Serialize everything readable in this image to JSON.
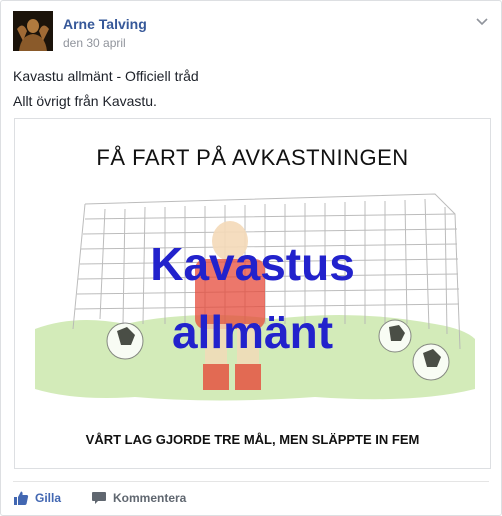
{
  "post": {
    "author": "Arne Talving",
    "date": "den 30 april",
    "line1": "Kavastu allmänt - Officiell tråd",
    "line2": "Allt övrigt från Kavastu."
  },
  "image": {
    "title": "FÅ FART PÅ AVKASTNINGEN",
    "big_line1": "Kavastus",
    "big_line2": "allmänt",
    "bottom": "VÅRT LAG GJORDE TRE MÅL, MEN SLÄPPTE IN FEM"
  },
  "actions": {
    "like_label": "Gilla",
    "comment_label": "Kommentera"
  },
  "colors": {
    "link": "#365899",
    "like": "#4267b2",
    "image_text": "#2222cc"
  },
  "icons": [
    "chevron-down-icon",
    "like-icon",
    "comment-icon"
  ]
}
